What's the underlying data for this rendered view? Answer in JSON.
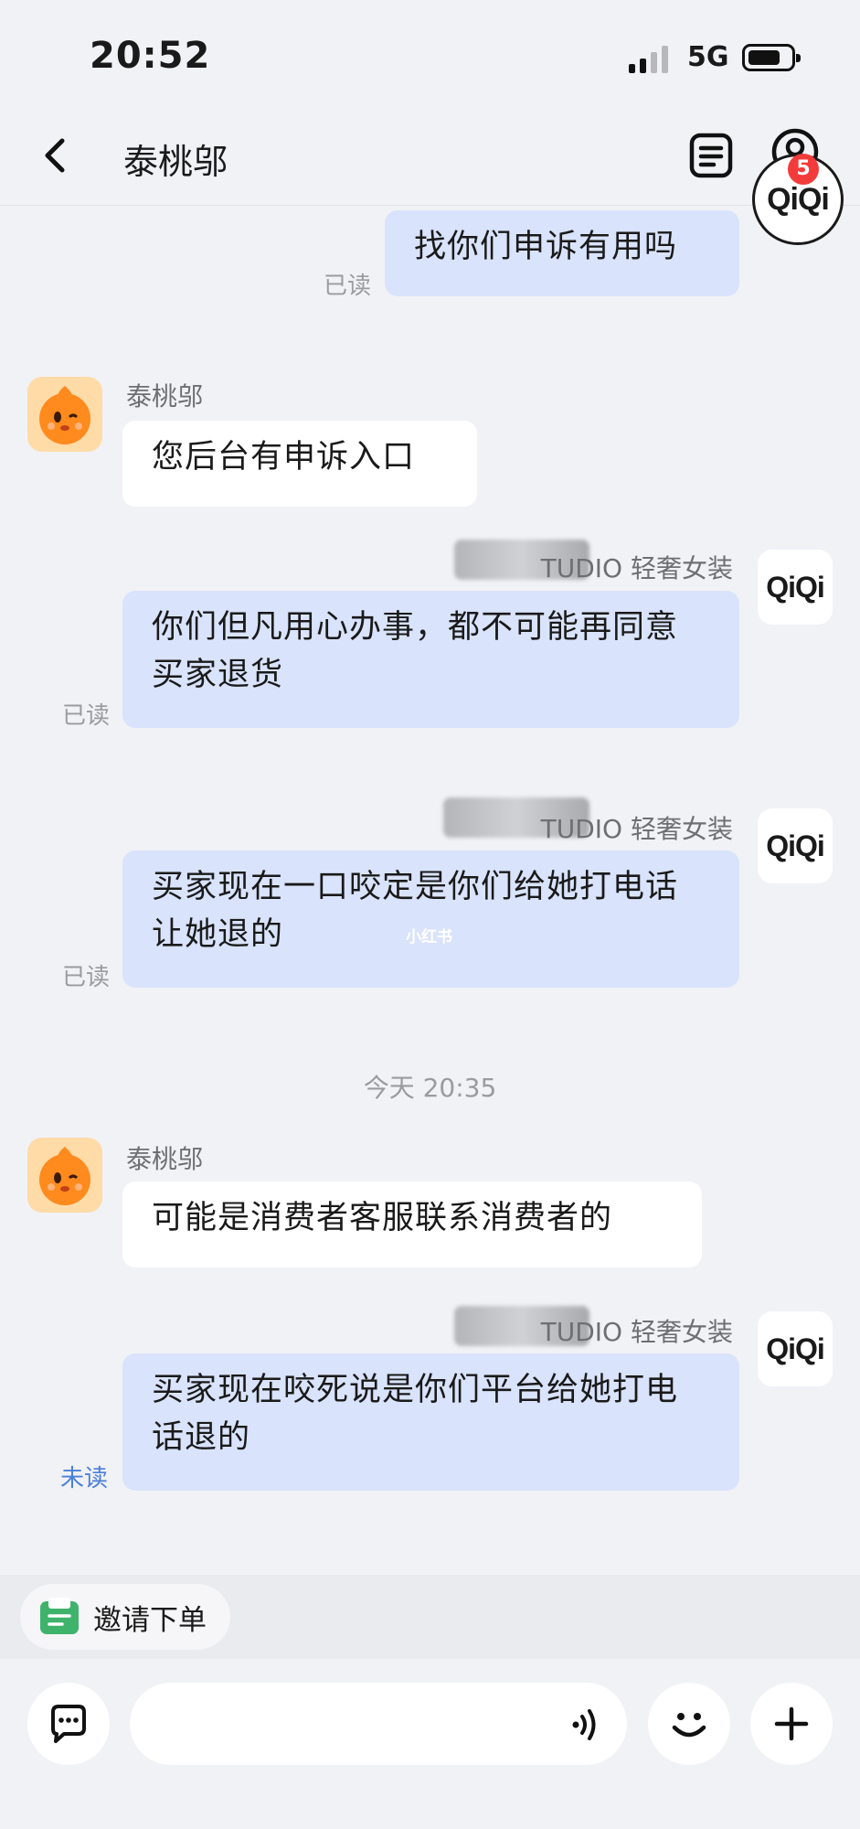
{
  "status_bar": {
    "time": "20:52",
    "network": "5G"
  },
  "nav": {
    "title": "泰桃邬",
    "profile_badge_text": "QiQi",
    "notification_count": "5"
  },
  "messages": [
    {
      "text": "找你们申诉有用吗",
      "read": "已读"
    },
    {
      "sender": "泰桃邬",
      "text": "您后台有申诉入口"
    },
    {
      "shop_label": "TUDIO 轻奢女装",
      "avatar": "QiQi",
      "text": "你们但凡用心办事，都不可能再同意买家退货",
      "read": "已读"
    },
    {
      "shop_label": "TUDIO 轻奢女装",
      "avatar": "QiQi",
      "text": "买家现在一口咬定是你们给她打电话让她退的",
      "read": "已读"
    },
    {
      "sender": "泰桃邬",
      "text": "可能是消费者客服联系消费者的"
    },
    {
      "shop_label": "TUDIO 轻奢女装",
      "avatar": "QiQi",
      "text": "买家现在咬死说是你们平台给她打电话退的",
      "read": "未读"
    }
  ],
  "timestamp": "今天 20:35",
  "watermark": "小红书",
  "quick_actions": {
    "invite_order": "邀请下单"
  },
  "input": {
    "placeholder": ""
  },
  "colors": {
    "outgoing_bubble": "#d9e3fb",
    "incoming_bubble": "#ffffff",
    "unread": "#4a7fdb",
    "background": "#f1f2f6"
  }
}
